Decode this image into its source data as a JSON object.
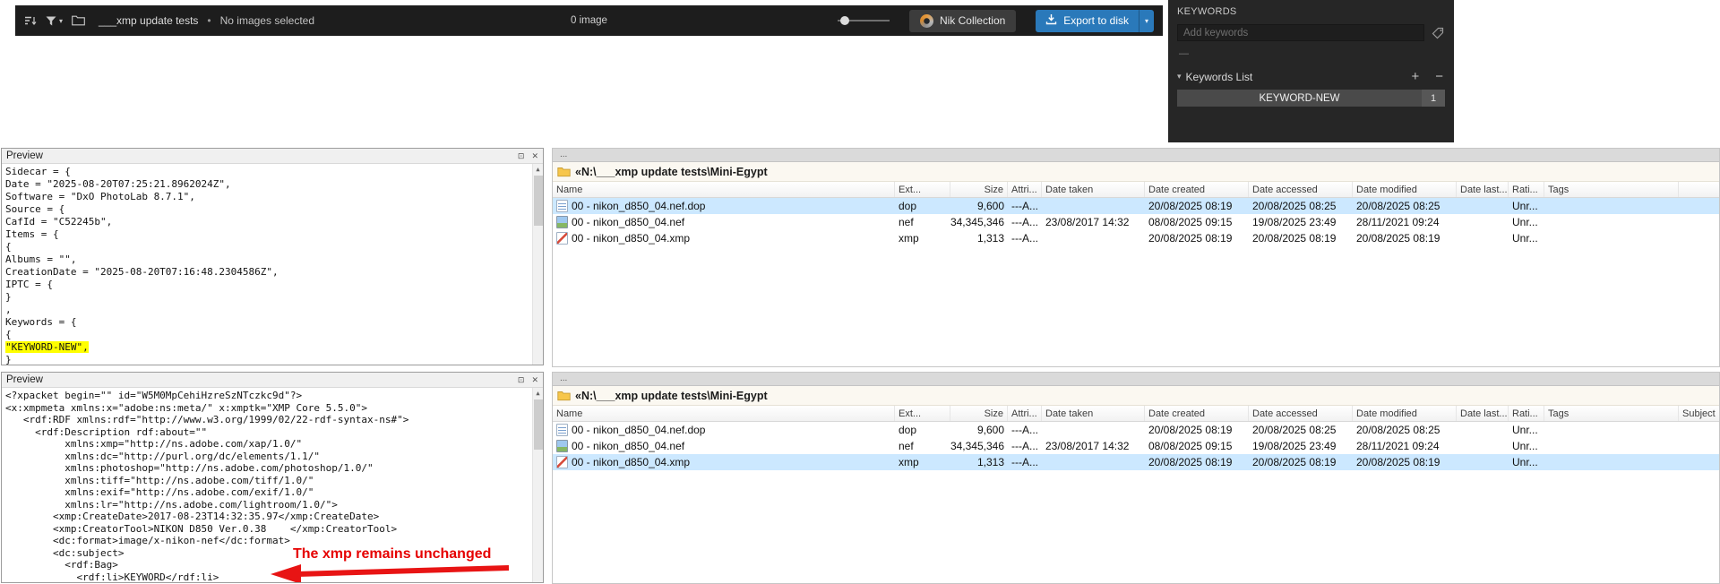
{
  "colors": {
    "accent_blue": "#2a79ba",
    "selection_blue": "#cce8ff",
    "highlight_yellow": "#ffff00",
    "annotation_red": "#e60000",
    "panel_dark": "#262626"
  },
  "icons": {
    "close": "✕",
    "pin": "⊡",
    "scroll_up": "▲",
    "caret_down": "▾",
    "bullet": "•"
  },
  "toolbar": {
    "folder_name": "___xmp update tests",
    "status": "No images selected",
    "count_label": "0 image",
    "nik_label": "Nik Collection",
    "export_label": "Export to disk"
  },
  "keywords_panel": {
    "title": "KEYWORDS",
    "input_placeholder": "Add keywords",
    "no_keywords_dash": "—",
    "list_title": "Keywords List",
    "plus": "+",
    "minus": "−",
    "keyword": {
      "label": "KEYWORD-NEW",
      "count": "1"
    }
  },
  "preview_sidecar": {
    "title": "Preview",
    "lines": [
      {
        "t": "Sidecar = {"
      },
      {
        "t": "Date = \"2025-08-20T07:25:21.8962024Z\","
      },
      {
        "t": "Software = \"DxO PhotoLab 8.7.1\","
      },
      {
        "t": "Source = {"
      },
      {
        "t": "CafId = \"C52245b\","
      },
      {
        "t": "Items = {"
      },
      {
        "t": "{"
      },
      {
        "t": "Albums = \"\","
      },
      {
        "t": "CreationDate = \"2025-08-20T07:16:48.2304586Z\","
      },
      {
        "t": "IPTC = {"
      },
      {
        "t": "}"
      },
      {
        "t": ","
      },
      {
        "t": "Keywords = {"
      },
      {
        "t": "{"
      },
      {
        "t": "\"KEYWORD-NEW\",",
        "hl": true
      },
      {
        "t": "}"
      }
    ]
  },
  "preview_xmp": {
    "title": "Preview",
    "annotation": "The xmp remains unchanged",
    "lines": [
      {
        "t": "<?xpacket begin=\"\" id=\"W5M0MpCehiHzreSzNTczkc9d\"?>"
      },
      {
        "t": "<x:xmpmeta xmlns:x=\"adobe:ns:meta/\" x:xmptk=\"XMP Core 5.5.0\">"
      },
      {
        "t": "   <rdf:RDF xmlns:rdf=\"http://www.w3.org/1999/02/22-rdf-syntax-ns#\">"
      },
      {
        "t": "     <rdf:Description rdf:about=\"\""
      },
      {
        "t": "          xmlns:xmp=\"http://ns.adobe.com/xap/1.0/\""
      },
      {
        "t": "          xmlns:dc=\"http://purl.org/dc/elements/1.1/\""
      },
      {
        "t": "          xmlns:photoshop=\"http://ns.adobe.com/photoshop/1.0/\""
      },
      {
        "t": "          xmlns:tiff=\"http://ns.adobe.com/tiff/1.0/\""
      },
      {
        "t": "          xmlns:exif=\"http://ns.adobe.com/exif/1.0/\""
      },
      {
        "t": "          xmlns:lr=\"http://ns.adobe.com/lightroom/1.0/\">"
      },
      {
        "t": "        <xmp:CreateDate>2017-08-23T14:32:35.97</xmp:CreateDate>"
      },
      {
        "t": "        <xmp:CreatorTool>NIKON D850 Ver.0.38    </xmp:CreatorTool>"
      },
      {
        "t": "        <dc:format>image/x-nikon-nef</dc:format>"
      },
      {
        "t": "        <dc:subject>"
      },
      {
        "t": "          <rdf:Bag>"
      },
      {
        "t": "            <rdf:li>KEYWORD</rdf:li>"
      }
    ]
  },
  "explorer_top": {
    "tab_label": "...",
    "path": "«N:\\___xmp update tests\\Mini-Egypt",
    "columns": [
      "Name",
      "Ext...",
      "Size",
      "Attri...",
      "Date taken",
      "Date created",
      "Date accessed",
      "Date modified",
      "Date last...",
      "Rati...",
      "Tags"
    ],
    "rows": [
      {
        "icon": "dop",
        "name": "00 - nikon_d850_04.nef.dop",
        "ext": "dop",
        "size": "9,600",
        "attr": "---A...",
        "taken": "",
        "created": "20/08/2025 08:19",
        "accessed": "20/08/2025 08:25",
        "modified": "20/08/2025 08:25",
        "last": "",
        "rating": "Unr...",
        "tags": "",
        "subject": "",
        "selected": true
      },
      {
        "icon": "nef",
        "name": "00 - nikon_d850_04.nef",
        "ext": "nef",
        "size": "34,345,346",
        "attr": "---A...",
        "taken": "23/08/2017 14:32",
        "created": "08/08/2025 09:15",
        "accessed": "19/08/2025 23:49",
        "modified": "28/11/2021 09:24",
        "last": "",
        "rating": "Unr...",
        "tags": "",
        "subject": "",
        "selected": false
      },
      {
        "icon": "xmp",
        "name": "00 - nikon_d850_04.xmp",
        "ext": "xmp",
        "size": "1,313",
        "attr": "---A...",
        "taken": "",
        "created": "20/08/2025 08:19",
        "accessed": "20/08/2025 08:19",
        "modified": "20/08/2025 08:19",
        "last": "",
        "rating": "Unr...",
        "tags": "",
        "subject": "",
        "selected": false
      }
    ]
  },
  "explorer_bottom": {
    "tab_label": "...",
    "path": "«N:\\___xmp update tests\\Mini-Egypt",
    "columns": [
      "Name",
      "Ext...",
      "Size",
      "Attri...",
      "Date taken",
      "Date created",
      "Date accessed",
      "Date modified",
      "Date last...",
      "Rati...",
      "Tags",
      "Subject"
    ],
    "rows": [
      {
        "icon": "dop",
        "name": "00 - nikon_d850_04.nef.dop",
        "ext": "dop",
        "size": "9,600",
        "attr": "---A...",
        "taken": "",
        "created": "20/08/2025 08:19",
        "accessed": "20/08/2025 08:25",
        "modified": "20/08/2025 08:25",
        "last": "",
        "rating": "Unr...",
        "tags": "",
        "subject": "",
        "selected": false
      },
      {
        "icon": "nef",
        "name": "00 - nikon_d850_04.nef",
        "ext": "nef",
        "size": "34,345,346",
        "attr": "---A...",
        "taken": "23/08/2017 14:32",
        "created": "08/08/2025 09:15",
        "accessed": "19/08/2025 23:49",
        "modified": "28/11/2021 09:24",
        "last": "",
        "rating": "Unr...",
        "tags": "",
        "subject": "",
        "selected": false
      },
      {
        "icon": "xmp",
        "name": "00 - nikon_d850_04.xmp",
        "ext": "xmp",
        "size": "1,313",
        "attr": "---A...",
        "taken": "",
        "created": "20/08/2025 08:19",
        "accessed": "20/08/2025 08:19",
        "modified": "20/08/2025 08:19",
        "last": "",
        "rating": "Unr...",
        "tags": "",
        "subject": "",
        "selected": true
      }
    ]
  }
}
